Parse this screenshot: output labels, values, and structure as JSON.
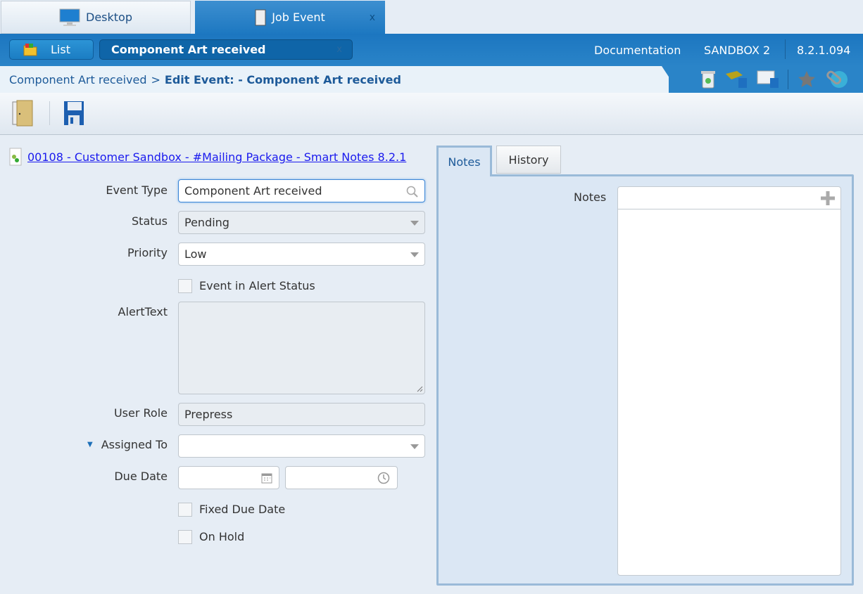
{
  "window_tabs": [
    {
      "label": "Desktop",
      "icon": "monitor-icon"
    },
    {
      "label": "Job Event",
      "icon": "clipboard-icon",
      "close": "x"
    }
  ],
  "nav": {
    "list_label": "List",
    "record_label": "Component Art received",
    "record_close": "x",
    "documentation": "Documentation",
    "environment": "SANDBOX 2",
    "version": "8.2.1.094"
  },
  "breadcrumb": {
    "parent": "Component Art received",
    "separator": ">",
    "current": "Edit Event: - Component Art received"
  },
  "header_icons": [
    "trash-icon",
    "flag-icon",
    "window-icon",
    "star-icon",
    "globe-link-icon"
  ],
  "toolbar": {
    "icons": [
      "exit-door-icon",
      "save-icon"
    ]
  },
  "job_link": "00108 - Customer Sandbox - #Mailing Package - Smart Notes 8.2.1",
  "form": {
    "event_type": {
      "label": "Event Type",
      "value": "Component Art received"
    },
    "status": {
      "label": "Status",
      "value": "Pending"
    },
    "priority": {
      "label": "Priority",
      "value": "Low"
    },
    "alert_status": {
      "label": "Event in Alert Status",
      "checked": false
    },
    "alert_text": {
      "label": "AlertText",
      "value": ""
    },
    "user_role": {
      "label": "User Role",
      "value": "Prepress"
    },
    "assigned_to": {
      "label": "Assigned To",
      "value": ""
    },
    "due_date": {
      "label": "Due Date",
      "date": "",
      "time": ""
    },
    "fixed_due_date": {
      "label": "Fixed Due Date",
      "checked": false
    },
    "on_hold": {
      "label": "On Hold",
      "checked": false
    }
  },
  "right_tabs": [
    {
      "label": "Notes",
      "active": true
    },
    {
      "label": "History",
      "active": false
    }
  ],
  "notes": {
    "label": "Notes",
    "value": ""
  }
}
